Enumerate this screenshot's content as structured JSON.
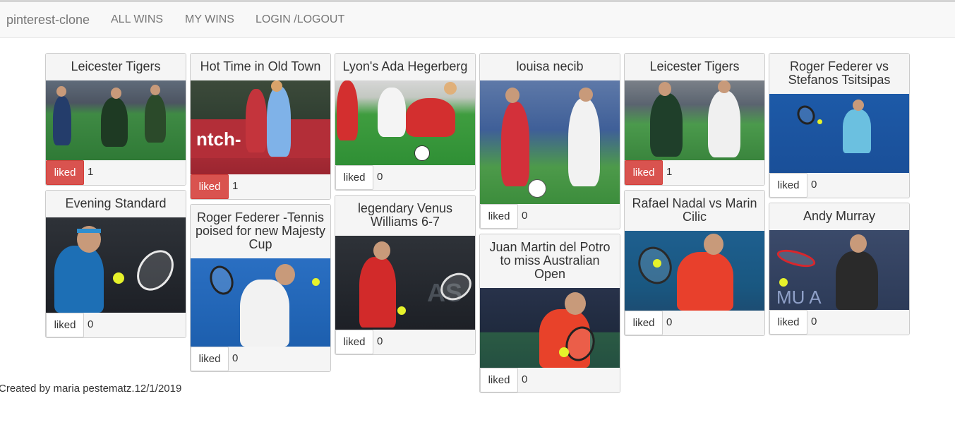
{
  "navbar": {
    "brand": "pinterest-clone",
    "links": [
      "ALL WINS",
      "MY WINS",
      "LOGIN /LOGOUT"
    ]
  },
  "columns": [
    [
      {
        "title": "Leicester Tigers",
        "liked_label": "liked",
        "liked": true,
        "count": "1",
        "image": "rugby-players-photo"
      },
      {
        "title": "Evening Standard",
        "liked_label": "liked",
        "liked": false,
        "count": "0",
        "image": "tennis-forehand-photo"
      }
    ],
    [
      {
        "title": "Hot Time in Old Town",
        "liked_label": "liked",
        "liked": true,
        "count": "1",
        "image": "soccer-women-photo"
      },
      {
        "title": "Roger Federer -Tennis poised for new Majesty Cup",
        "liked_label": "liked",
        "liked": false,
        "count": "0",
        "image": "tennis-serve-photo"
      }
    ],
    [
      {
        "title": "Lyon's Ada Hegerberg",
        "liked_label": "liked",
        "liked": false,
        "count": "0",
        "image": "soccer-tackle-photo"
      },
      {
        "title": "legendary Venus Williams 6-7",
        "liked_label": "liked",
        "liked": false,
        "count": "0",
        "image": "tennis-backhand-photo"
      }
    ],
    [
      {
        "title": "louisa necib",
        "liked_label": "liked",
        "liked": false,
        "count": "0",
        "image": "soccer-duel-photo"
      },
      {
        "title": "Juan Martin del Potro to miss Australian Open",
        "liked_label": "liked",
        "liked": false,
        "count": "0",
        "image": "tennis-player-photo"
      }
    ],
    [
      {
        "title": "Leicester Tigers",
        "liked_label": "liked",
        "liked": true,
        "count": "1",
        "image": "rugby-runner-photo"
      },
      {
        "title": "Rafael Nadal vs Marin Cilic",
        "liked_label": "liked",
        "liked": false,
        "count": "0",
        "image": "tennis-swing-photo"
      }
    ],
    [
      {
        "title": "Roger Federer vs Stefanos Tsitsipas",
        "liked_label": "liked",
        "liked": false,
        "count": "0",
        "image": "tennis-reach-photo"
      },
      {
        "title": "Andy Murray",
        "liked_label": "liked",
        "liked": false,
        "count": "0",
        "image": "tennis-forehand-photo"
      }
    ]
  ],
  "footer": {
    "text": "Created by maria pestematz.12/1/2019"
  },
  "colors": {
    "liked_button": "#d9534f",
    "navbar_bg": "#f8f8f8",
    "card_header_bg": "#f5f5f5"
  }
}
